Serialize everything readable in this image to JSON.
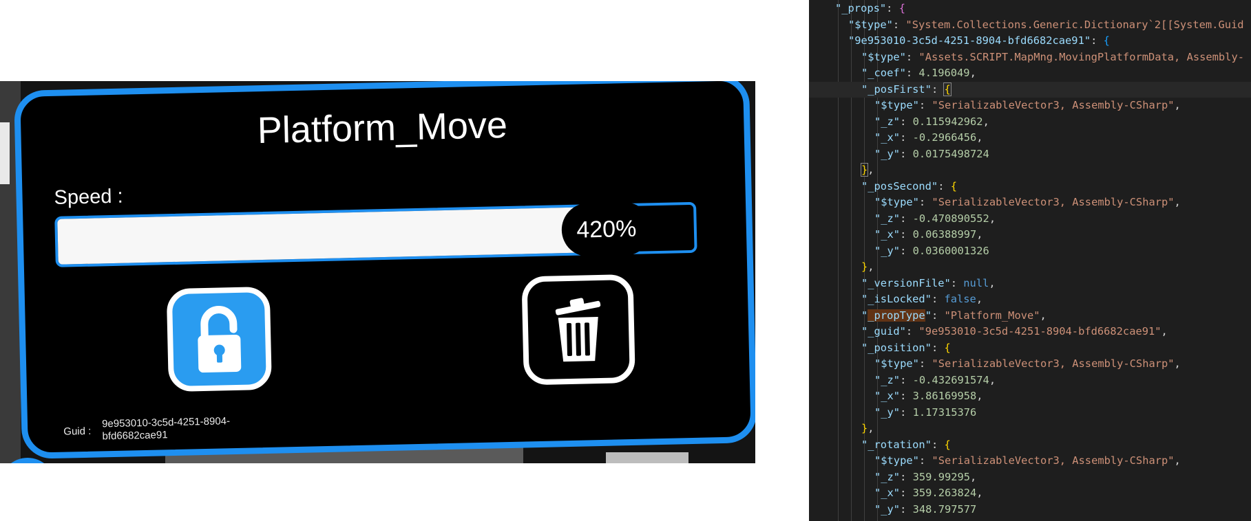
{
  "vr_panel": {
    "title": "Platform_Move",
    "speed_label": "Speed :",
    "speed_value": "420%",
    "speed_fill_fraction": 0.8,
    "guid_label": "Guid :",
    "guid_value": "9e953010-3c5d-4251-8904-bfd6682cae91",
    "lock_icon": "lock-icon",
    "trash_icon": "trash-icon",
    "accent_color": "#1e8ff0"
  },
  "editor": {
    "colors": {
      "key": "#9cdcfe",
      "string": "#ce9178",
      "number": "#b5cea8",
      "literal": "#569cd6",
      "punctuation": "#d4d4d4",
      "background": "#1e1e1e"
    },
    "lines": [
      {
        "indent": 1,
        "tokens": [
          {
            "t": "\"_props\"",
            "c": "k"
          },
          {
            "t": ": ",
            "c": "p"
          },
          {
            "t": "{",
            "c": "b1"
          }
        ]
      },
      {
        "indent": 2,
        "tokens": [
          {
            "t": "\"$type\"",
            "c": "k"
          },
          {
            "t": ": ",
            "c": "p"
          },
          {
            "t": "\"System.Collections.Generic.Dictionary`2[[System.Guid",
            "c": "s"
          }
        ]
      },
      {
        "indent": 2,
        "tokens": [
          {
            "t": "\"9e953010-3c5d-4251-8904-bfd6682cae91\"",
            "c": "k"
          },
          {
            "t": ": ",
            "c": "p"
          },
          {
            "t": "{",
            "c": "b2"
          }
        ]
      },
      {
        "indent": 3,
        "tokens": [
          {
            "t": "\"$type\"",
            "c": "k"
          },
          {
            "t": ": ",
            "c": "p"
          },
          {
            "t": "\"Assets.SCRIPT.MapMng.MovingPlatformData, Assembly-",
            "c": "s"
          }
        ]
      },
      {
        "indent": 3,
        "tokens": [
          {
            "t": "\"_coef\"",
            "c": "k"
          },
          {
            "t": ": ",
            "c": "p"
          },
          {
            "t": "4.196049",
            "c": "n"
          },
          {
            "t": ",",
            "c": "p"
          }
        ]
      },
      {
        "indent": 3,
        "current": true,
        "tokens": [
          {
            "t": "\"_posFirst\"",
            "c": "k"
          },
          {
            "t": ": ",
            "c": "p"
          },
          {
            "t": "{",
            "c": "b3",
            "box": true
          }
        ]
      },
      {
        "indent": 4,
        "tokens": [
          {
            "t": "\"$type\"",
            "c": "k"
          },
          {
            "t": ": ",
            "c": "p"
          },
          {
            "t": "\"SerializableVector3, Assembly-CSharp\"",
            "c": "s"
          },
          {
            "t": ",",
            "c": "p"
          }
        ]
      },
      {
        "indent": 4,
        "tokens": [
          {
            "t": "\"_z\"",
            "c": "k"
          },
          {
            "t": ": ",
            "c": "p"
          },
          {
            "t": "0.115942962",
            "c": "n"
          },
          {
            "t": ",",
            "c": "p"
          }
        ]
      },
      {
        "indent": 4,
        "tokens": [
          {
            "t": "\"_x\"",
            "c": "k"
          },
          {
            "t": ": ",
            "c": "p"
          },
          {
            "t": "-0.2966456",
            "c": "n"
          },
          {
            "t": ",",
            "c": "p"
          }
        ]
      },
      {
        "indent": 4,
        "tokens": [
          {
            "t": "\"_y\"",
            "c": "k"
          },
          {
            "t": ": ",
            "c": "p"
          },
          {
            "t": "0.0175498724",
            "c": "n"
          }
        ]
      },
      {
        "indent": 3,
        "tokens": [
          {
            "t": "}",
            "c": "b3",
            "box": true
          },
          {
            "t": ",",
            "c": "p"
          }
        ]
      },
      {
        "indent": 3,
        "tokens": [
          {
            "t": "\"_posSecond\"",
            "c": "k"
          },
          {
            "t": ": ",
            "c": "p"
          },
          {
            "t": "{",
            "c": "b3"
          }
        ]
      },
      {
        "indent": 4,
        "tokens": [
          {
            "t": "\"$type\"",
            "c": "k"
          },
          {
            "t": ": ",
            "c": "p"
          },
          {
            "t": "\"SerializableVector3, Assembly-CSharp\"",
            "c": "s"
          },
          {
            "t": ",",
            "c": "p"
          }
        ]
      },
      {
        "indent": 4,
        "tokens": [
          {
            "t": "\"_z\"",
            "c": "k"
          },
          {
            "t": ": ",
            "c": "p"
          },
          {
            "t": "-0.470890552",
            "c": "n"
          },
          {
            "t": ",",
            "c": "p"
          }
        ]
      },
      {
        "indent": 4,
        "tokens": [
          {
            "t": "\"_x\"",
            "c": "k"
          },
          {
            "t": ": ",
            "c": "p"
          },
          {
            "t": "0.06388997",
            "c": "n"
          },
          {
            "t": ",",
            "c": "p"
          }
        ]
      },
      {
        "indent": 4,
        "tokens": [
          {
            "t": "\"_y\"",
            "c": "k"
          },
          {
            "t": ": ",
            "c": "p"
          },
          {
            "t": "0.0360001326",
            "c": "n"
          }
        ]
      },
      {
        "indent": 3,
        "tokens": [
          {
            "t": "}",
            "c": "b3"
          },
          {
            "t": ",",
            "c": "p"
          }
        ]
      },
      {
        "indent": 3,
        "tokens": [
          {
            "t": "\"_versionFile\"",
            "c": "k"
          },
          {
            "t": ": ",
            "c": "p"
          },
          {
            "t": "null",
            "c": "c"
          },
          {
            "t": ",",
            "c": "p"
          }
        ]
      },
      {
        "indent": 3,
        "tokens": [
          {
            "t": "\"_isLocked\"",
            "c": "k"
          },
          {
            "t": ": ",
            "c": "p"
          },
          {
            "t": "false",
            "c": "c"
          },
          {
            "t": ",",
            "c": "p"
          }
        ]
      },
      {
        "indent": 3,
        "tokens": [
          {
            "t": "\"",
            "c": "k"
          },
          {
            "t": "_propType",
            "c": "k",
            "hl": true
          },
          {
            "t": "\"",
            "c": "k"
          },
          {
            "t": ": ",
            "c": "p"
          },
          {
            "t": "\"Platform_Move\"",
            "c": "s"
          },
          {
            "t": ",",
            "c": "p"
          }
        ]
      },
      {
        "indent": 3,
        "tokens": [
          {
            "t": "\"_guid\"",
            "c": "k"
          },
          {
            "t": ": ",
            "c": "p"
          },
          {
            "t": "\"9e953010-3c5d-4251-8904-bfd6682cae91\"",
            "c": "s"
          },
          {
            "t": ",",
            "c": "p"
          }
        ]
      },
      {
        "indent": 3,
        "tokens": [
          {
            "t": "\"_position\"",
            "c": "k"
          },
          {
            "t": ": ",
            "c": "p"
          },
          {
            "t": "{",
            "c": "b3"
          }
        ]
      },
      {
        "indent": 4,
        "tokens": [
          {
            "t": "\"$type\"",
            "c": "k"
          },
          {
            "t": ": ",
            "c": "p"
          },
          {
            "t": "\"SerializableVector3, Assembly-CSharp\"",
            "c": "s"
          },
          {
            "t": ",",
            "c": "p"
          }
        ]
      },
      {
        "indent": 4,
        "tokens": [
          {
            "t": "\"_z\"",
            "c": "k"
          },
          {
            "t": ": ",
            "c": "p"
          },
          {
            "t": "-0.432691574",
            "c": "n"
          },
          {
            "t": ",",
            "c": "p"
          }
        ]
      },
      {
        "indent": 4,
        "tokens": [
          {
            "t": "\"_x\"",
            "c": "k"
          },
          {
            "t": ": ",
            "c": "p"
          },
          {
            "t": "3.86169958",
            "c": "n"
          },
          {
            "t": ",",
            "c": "p"
          }
        ]
      },
      {
        "indent": 4,
        "tokens": [
          {
            "t": "\"_y\"",
            "c": "k"
          },
          {
            "t": ": ",
            "c": "p"
          },
          {
            "t": "1.17315376",
            "c": "n"
          }
        ]
      },
      {
        "indent": 3,
        "tokens": [
          {
            "t": "}",
            "c": "b3"
          },
          {
            "t": ",",
            "c": "p"
          }
        ]
      },
      {
        "indent": 3,
        "tokens": [
          {
            "t": "\"_rotation\"",
            "c": "k"
          },
          {
            "t": ": ",
            "c": "p"
          },
          {
            "t": "{",
            "c": "b3"
          }
        ]
      },
      {
        "indent": 4,
        "tokens": [
          {
            "t": "\"$type\"",
            "c": "k"
          },
          {
            "t": ": ",
            "c": "p"
          },
          {
            "t": "\"SerializableVector3, Assembly-CSharp\"",
            "c": "s"
          },
          {
            "t": ",",
            "c": "p"
          }
        ]
      },
      {
        "indent": 4,
        "tokens": [
          {
            "t": "\"_z\"",
            "c": "k"
          },
          {
            "t": ": ",
            "c": "p"
          },
          {
            "t": "359.99295",
            "c": "n"
          },
          {
            "t": ",",
            "c": "p"
          }
        ]
      },
      {
        "indent": 4,
        "tokens": [
          {
            "t": "\"_x\"",
            "c": "k"
          },
          {
            "t": ": ",
            "c": "p"
          },
          {
            "t": "359.263824",
            "c": "n"
          },
          {
            "t": ",",
            "c": "p"
          }
        ]
      },
      {
        "indent": 4,
        "tokens": [
          {
            "t": "\"_y\"",
            "c": "k"
          },
          {
            "t": ": ",
            "c": "p"
          },
          {
            "t": "348.797577",
            "c": "n"
          }
        ]
      }
    ]
  }
}
